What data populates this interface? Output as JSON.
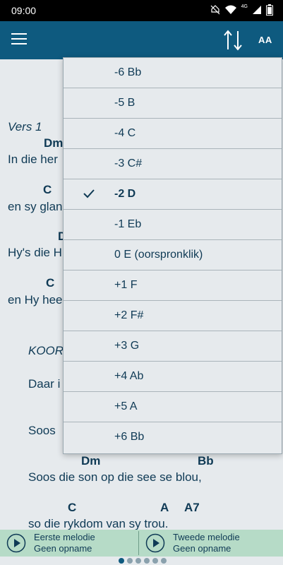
{
  "status_bar": {
    "time": "09:00",
    "network": "4G"
  },
  "app_bar": {
    "font_size_label": "AA"
  },
  "song": {
    "verse_label": "Vers 1",
    "chorus_label": "KOOR",
    "lines": [
      {
        "chord": "Dm",
        "text": "In die her"
      },
      {
        "chord": "C",
        "text": "en sy glan"
      },
      {
        "chord": "D",
        "text": "Hy's die H"
      },
      {
        "chord": "C",
        "text": "en Hy hee"
      },
      {
        "text": "Daar i"
      },
      {
        "text": "Soos"
      },
      {
        "chord_a": "Dm",
        "chord_b": "Bb",
        "text": "Soos die  son op die see se blou,"
      },
      {
        "chord_a": "C",
        "chord_b": "A",
        "chord_c": "A7",
        "text": "so die rykdom van sy trou."
      }
    ]
  },
  "transpose_menu": {
    "items": [
      {
        "label": "-6   Bb",
        "selected": false
      },
      {
        "label": "-5   B",
        "selected": false
      },
      {
        "label": "-4   C",
        "selected": false
      },
      {
        "label": "-3   C#",
        "selected": false
      },
      {
        "label": "-2   D",
        "selected": true
      },
      {
        "label": "-1   Eb",
        "selected": false
      },
      {
        "label": "0   E (oorspronklik)",
        "selected": false
      },
      {
        "label": "+1   F",
        "selected": false
      },
      {
        "label": "+2   F#",
        "selected": false
      },
      {
        "label": "+3   G",
        "selected": false
      },
      {
        "label": "+4   Ab",
        "selected": false
      },
      {
        "label": "+5   A",
        "selected": false
      },
      {
        "label": "+6   Bb",
        "selected": false
      }
    ]
  },
  "player": {
    "first": {
      "title": "Eerste melodie",
      "subtitle": "Geen opname"
    },
    "second": {
      "title": "Tweede melodie",
      "subtitle": "Geen opname"
    }
  },
  "colors": {
    "app_bar": "#0e5a7f",
    "text": "#0f3a55",
    "background": "#e6eaed",
    "player_bar": "#b6dbc7"
  }
}
